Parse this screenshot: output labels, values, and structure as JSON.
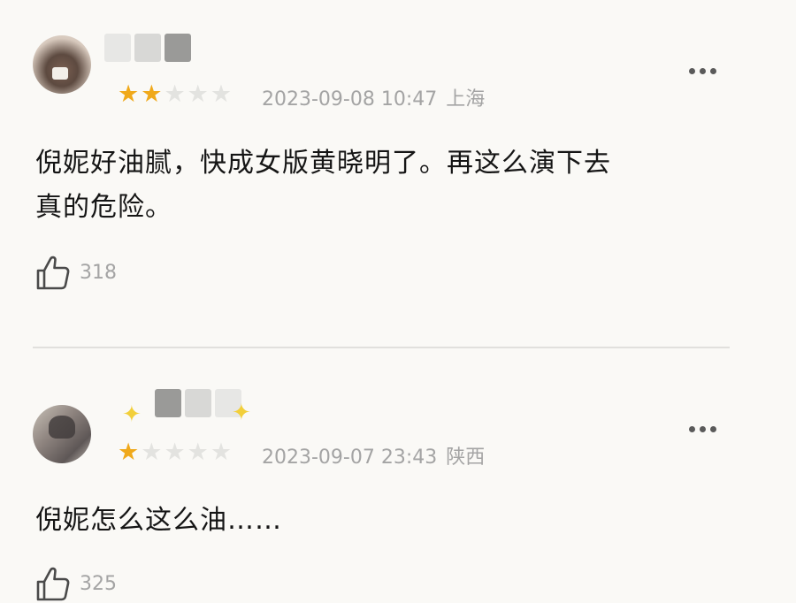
{
  "reviews": [
    {
      "rating": 2,
      "max_rating": 5,
      "date": "2023-09-08 10:47",
      "location": "上海",
      "content_line1": "倪妮好油腻，快成女版黄晓明了。再这么演下去",
      "content_line2": "真的危险。",
      "likes": "318"
    },
    {
      "rating": 1,
      "max_rating": 5,
      "date": "2023-09-07 23:43",
      "location": "陕西",
      "content_line1": "倪妮怎么这么油……",
      "likes": "325"
    }
  ],
  "icons": {
    "star": "★",
    "sparkle": "✦",
    "more": "more-icon",
    "like": "thumbs-up-icon"
  },
  "colors": {
    "background": "#faf9f6",
    "star_active": "#f0a91b",
    "star_inactive": "#e3e3e0",
    "meta_text": "#a4a4a4",
    "body_text": "#151515",
    "sparkle": "#f2cf3a"
  }
}
